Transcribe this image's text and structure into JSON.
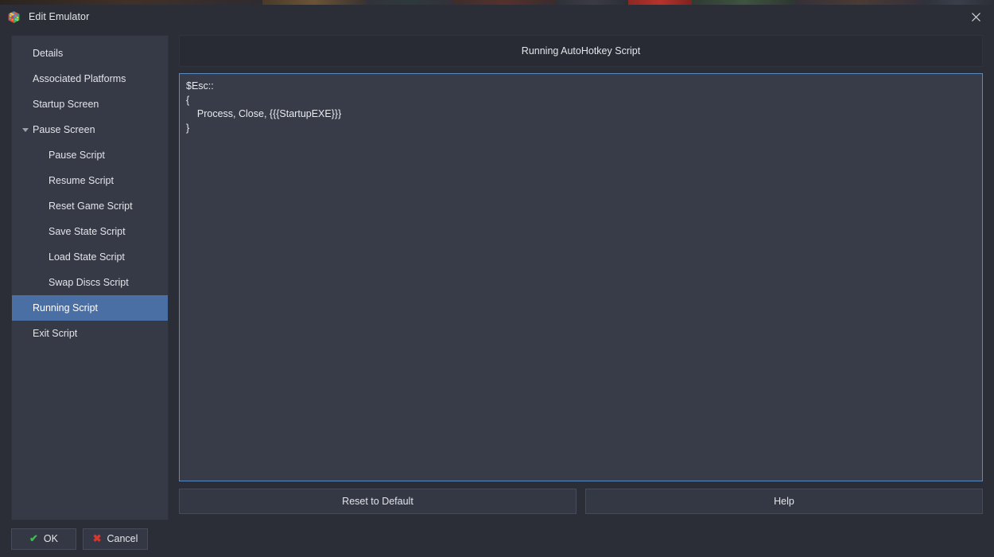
{
  "window": {
    "title": "Edit Emulator",
    "icon": "launchbox-cube-icon",
    "close_label": "✕"
  },
  "sidebar": {
    "items": [
      {
        "label": "Details",
        "level": 0,
        "selected": false,
        "expander": false
      },
      {
        "label": "Associated Platforms",
        "level": 0,
        "selected": false,
        "expander": false
      },
      {
        "label": "Startup Screen",
        "level": 0,
        "selected": false,
        "expander": false
      },
      {
        "label": "Pause Screen",
        "level": 0,
        "selected": false,
        "expander": true
      },
      {
        "label": "Pause Script",
        "level": 1,
        "selected": false,
        "expander": false
      },
      {
        "label": "Resume Script",
        "level": 1,
        "selected": false,
        "expander": false
      },
      {
        "label": "Reset Game Script",
        "level": 1,
        "selected": false,
        "expander": false
      },
      {
        "label": "Save State Script",
        "level": 1,
        "selected": false,
        "expander": false
      },
      {
        "label": "Load State Script",
        "level": 1,
        "selected": false,
        "expander": false
      },
      {
        "label": "Swap Discs Script",
        "level": 1,
        "selected": false,
        "expander": false
      },
      {
        "label": "Running Script",
        "level": 0,
        "selected": true,
        "expander": false
      },
      {
        "label": "Exit Script",
        "level": 0,
        "selected": false,
        "expander": false
      }
    ]
  },
  "content": {
    "header": "Running AutoHotkey Script",
    "script": "$Esc::\n{\n    Process, Close, {{{StartupEXE}}}\n}",
    "reset_label": "Reset to Default",
    "help_label": "Help"
  },
  "footer": {
    "ok_label": "OK",
    "ok_glyph": "✔",
    "cancel_label": "Cancel",
    "cancel_glyph": "✖"
  },
  "colors": {
    "accent_selection": "#4a6fa5",
    "focus_border": "#5a8ac4",
    "dialog_bg": "#2b2e37",
    "sidebar_bg": "#363a46",
    "editor_bg": "#383c49",
    "ok_green": "#35c14a",
    "cancel_red": "#d6382f"
  }
}
